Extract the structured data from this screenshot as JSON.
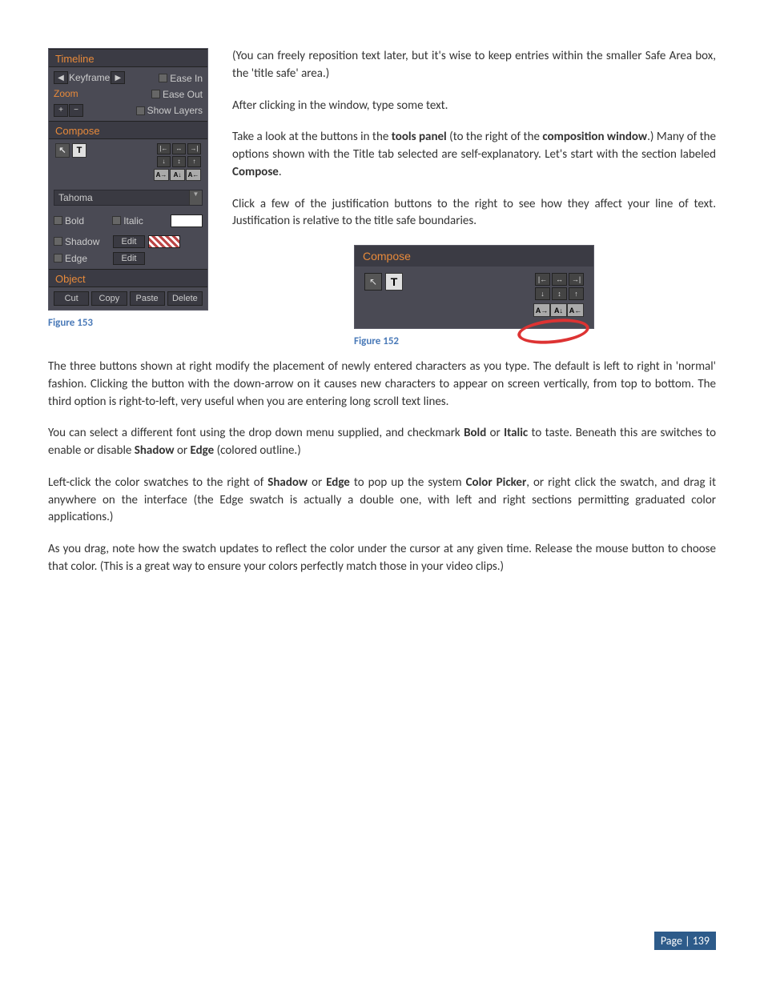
{
  "panel153": {
    "timeline": {
      "head": "Timeline",
      "keyframe": "Keyframe",
      "easeIn": "Ease In",
      "easeOut": "Ease Out",
      "showLayers": "Show Layers"
    },
    "zoom": {
      "head": "Zoom",
      "plus": "+",
      "minus": "−"
    },
    "compose": {
      "head": "Compose",
      "arrowTool": "▲",
      "textTool": "T",
      "dirLR": "A→",
      "dirDown": "A↓",
      "dirRL": "A←"
    },
    "font": {
      "name": "Tahoma"
    },
    "styles": {
      "bold": "Bold",
      "italic": "Italic",
      "shadow": "Shadow",
      "edge": "Edge",
      "edit": "Edit"
    },
    "object": {
      "head": "Object",
      "cut": "Cut",
      "copy": "Copy",
      "paste": "Paste",
      "del": "Delete"
    },
    "caption": "Figure 153"
  },
  "panel152": {
    "head": "Compose",
    "arrowTool": "▲",
    "textTool": "T",
    "dirLR": "A→",
    "dirDown": "A↓",
    "dirRL": "A←",
    "caption": "Figure 152"
  },
  "paras": {
    "p1": "(You can freely reposition text later, but it's wise to keep entries within the smaller Safe Area box, the 'title safe' area.)",
    "p2": "After clicking in the window, type some text.",
    "p3a": "Take a look at the buttons in the ",
    "p3b": "tools panel",
    "p3c": " (to the right of the ",
    "p3d": "composition window",
    "p3e": ".)  Many of the options shown with the Title tab selected are self-explanatory.  Let's start with the section labeled ",
    "p3f": "Compose",
    "p3g": ".",
    "p4": "Click a few of the justification buttons to the right to see how they affect your line of text.  Justification is relative to the title safe boundaries.",
    "p5": "The three buttons shown at right modify the placement of newly entered characters as you type.  The default is left to right in 'normal' fashion. Clicking the button with the down-arrow on it causes new characters to appear on screen vertically, from top to bottom.  The third option is right-to-left, very useful when you are entering long scroll text lines.",
    "p6a": "You can select a different font using the drop down menu supplied, and checkmark ",
    "p6b": "Bold",
    "p6c": " or ",
    "p6d": "Italic",
    "p6e": " to taste.  Beneath this are switches to enable or disable ",
    "p6f": "Shadow",
    "p6g": " or ",
    "p6h": "Edge",
    "p6i": " (colored outline.)",
    "p7a": "Left-click the color swatches to the right of ",
    "p7b": "Shadow",
    "p7c": " or ",
    "p7d": "Edge",
    "p7e": " to pop up the system ",
    "p7f": "Color Picker",
    "p7g": ", or right click the swatch, and drag it anywhere on the interface (the Edge swatch is actually a double one, with left and right sections permitting graduated color applications.)",
    "p8": "As you drag, note how the swatch updates to reflect the color under the cursor at any given time.  Release the mouse button to choose that color.  (This is a great way to ensure your colors perfectly match those in your video clips.)"
  },
  "page": "Page | 139"
}
